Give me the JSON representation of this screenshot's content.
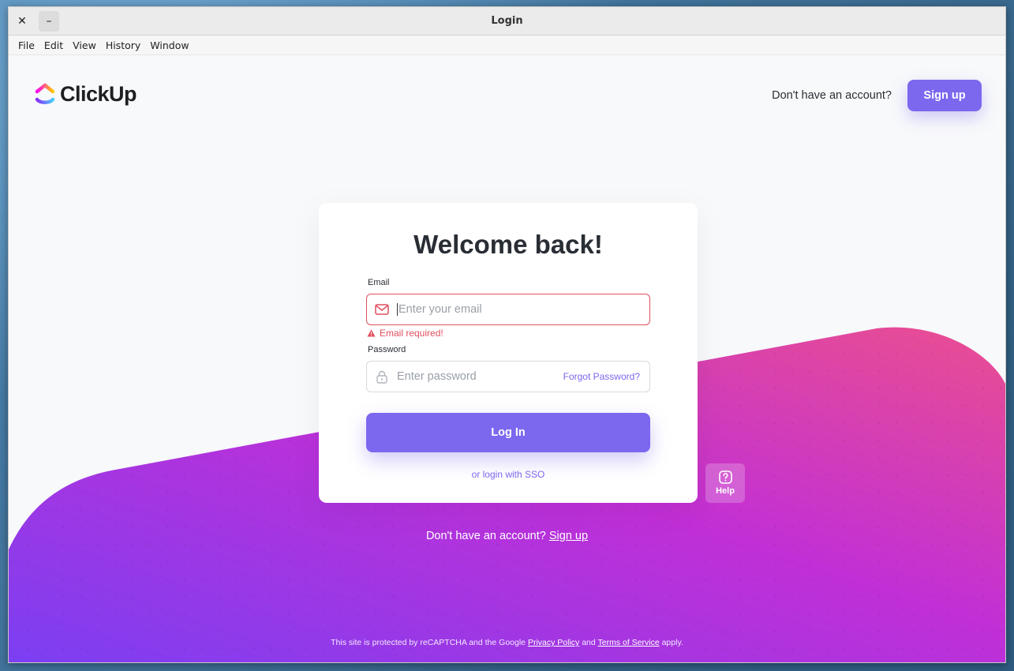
{
  "window": {
    "title": "Login",
    "close_glyph": "✕",
    "minimize_glyph": "–"
  },
  "menu": [
    "File",
    "Edit",
    "View",
    "History",
    "Window"
  ],
  "brand": {
    "name": "ClickUp",
    "icon": "clickup-logo-icon"
  },
  "header": {
    "question": "Don't have an account?",
    "signup_label": "Sign up"
  },
  "login": {
    "title": "Welcome back!",
    "email_label": "Email",
    "email_placeholder": "Enter your email",
    "email_error": "Email required!",
    "password_label": "Password",
    "password_placeholder": "Enter password",
    "forgot_label": "Forgot Password?",
    "login_button": "Log In",
    "sso_link": "or login with SSO"
  },
  "help": {
    "label": "Help",
    "icon": "question-circle-icon"
  },
  "footer": {
    "question": "Don't have an account?",
    "signup_link": "Sign up",
    "legal_prefix": "This site is protected by reCAPTCHA and the Google",
    "privacy_link": "Privacy Policy",
    "legal_and": "and",
    "terms_link": "Terms of Service",
    "legal_suffix": "apply."
  },
  "colors": {
    "accent": "#7b68ee",
    "error": "#e04f5f",
    "gradient_start": "#7b3ff2",
    "gradient_mid": "#c12fd6",
    "gradient_end": "#ea4f8f"
  }
}
